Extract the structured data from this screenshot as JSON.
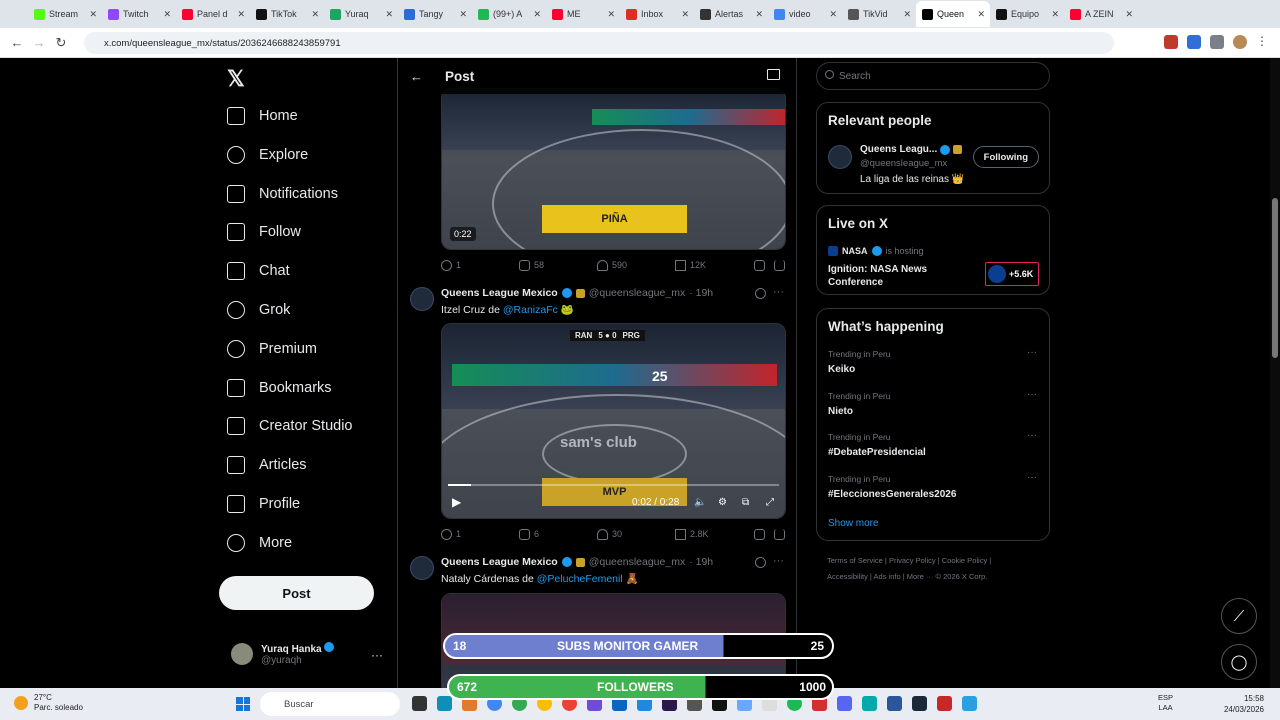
{
  "browser": {
    "tabs": [
      {
        "label": "Stream",
        "color": "#53fc18"
      },
      {
        "label": "Twitch",
        "color": "#9146ff"
      },
      {
        "label": "Panel d",
        "color": "#ff0033"
      },
      {
        "label": "TikTok",
        "color": "#111111"
      },
      {
        "label": "Yuraq",
        "color": "#1ea362"
      },
      {
        "label": "Tangy",
        "color": "#2b6cd6"
      },
      {
        "label": "(99+) A",
        "color": "#1db954"
      },
      {
        "label": "ME",
        "color": "#ff0033"
      },
      {
        "label": "Inbox",
        "color": "#d93025"
      },
      {
        "label": "Alertas",
        "color": "#333333"
      },
      {
        "label": "video",
        "color": "#4285f4"
      },
      {
        "label": "TikVid",
        "color": "#555555"
      },
      {
        "label": "Queen",
        "color": "#000000",
        "active": true
      },
      {
        "label": "Equipo",
        "color": "#111111"
      },
      {
        "label": "A ZEIN",
        "color": "#ff0033"
      }
    ],
    "url": "x.com/queensleague_mx/status/2036246688243859791"
  },
  "nav": {
    "items": [
      "Home",
      "Explore",
      "Notifications",
      "Follow",
      "Chat",
      "Grok",
      "Premium",
      "Bookmarks",
      "Creator Studio",
      "Articles",
      "Profile",
      "More"
    ],
    "post_label": "Post",
    "account_name": "Yuraq Hanka",
    "account_handle": "@yuraqh"
  },
  "main": {
    "header_title": "Post",
    "tweet0": {
      "video_time": "0:22",
      "banner_text": "PIÑA",
      "replies": "1",
      "reposts": "58",
      "likes": "590",
      "views": "12K"
    },
    "tweet1": {
      "name": "Queens League Mexico",
      "handle": "@queensleague_mx",
      "age": "· 19h",
      "text_prefix": "Itzel Cruz de",
      "mention": "@RanizaFc",
      "court_text": "sam's club",
      "banner_text": "MVP",
      "video_time": "0:02 / 0:28",
      "score_left": "RAN",
      "score": "5 ● 0",
      "score_right": "PRG",
      "player_number": "25",
      "replies": "1",
      "reposts": "6",
      "likes": "30",
      "views": "2.8K"
    },
    "tweet2": {
      "name": "Queens League Mexico",
      "handle": "@queensleague_mx",
      "age": "· 19h",
      "text_prefix": "Nataly Cárdenas de",
      "mention": "@PelucheFemenil"
    },
    "overlay": {
      "subs_left": "18",
      "subs_label": "SUBS MONITOR GAMER",
      "subs_right": "25",
      "followers_left": "672",
      "followers_label": "FOLLOWERS",
      "followers_right": "1000"
    }
  },
  "right": {
    "search_placeholder": "Search",
    "relevant_title": "Relevant people",
    "person_name": "Queens Leagu...",
    "person_handle": "@queensleague_mx",
    "person_bio": "La liga de las reinas 👑",
    "follow_label": "Following",
    "live_title": "Live on X",
    "live_host": "NASA",
    "live_hosting": "is hosting",
    "live_event": "Ignition: NASA News Conference",
    "live_count": "+5.6K",
    "happening_title": "What’s happening",
    "trends": [
      {
        "context": "Trending in Peru",
        "name": "Keiko"
      },
      {
        "context": "Trending in Peru",
        "name": "Nieto"
      },
      {
        "context": "Trending in Peru",
        "name": "#DebatePresidencial"
      },
      {
        "context": "Trending in Peru",
        "name": "#EleccionesGenerales2026"
      }
    ],
    "show_more": "Show more",
    "footer_line1": "Terms of Service  |  Privacy Policy  |  Cookie Policy  |",
    "footer_line2": "Accessibility  |  Ads info  |  More ···  © 2026 X Corp."
  },
  "taskbar": {
    "temp": "27°C",
    "weather": "Parc. soleado",
    "search": "Buscar",
    "lang_top": "ESP",
    "lang_bottom": "LAA",
    "time": "15:58",
    "date": "24/03/2026"
  }
}
